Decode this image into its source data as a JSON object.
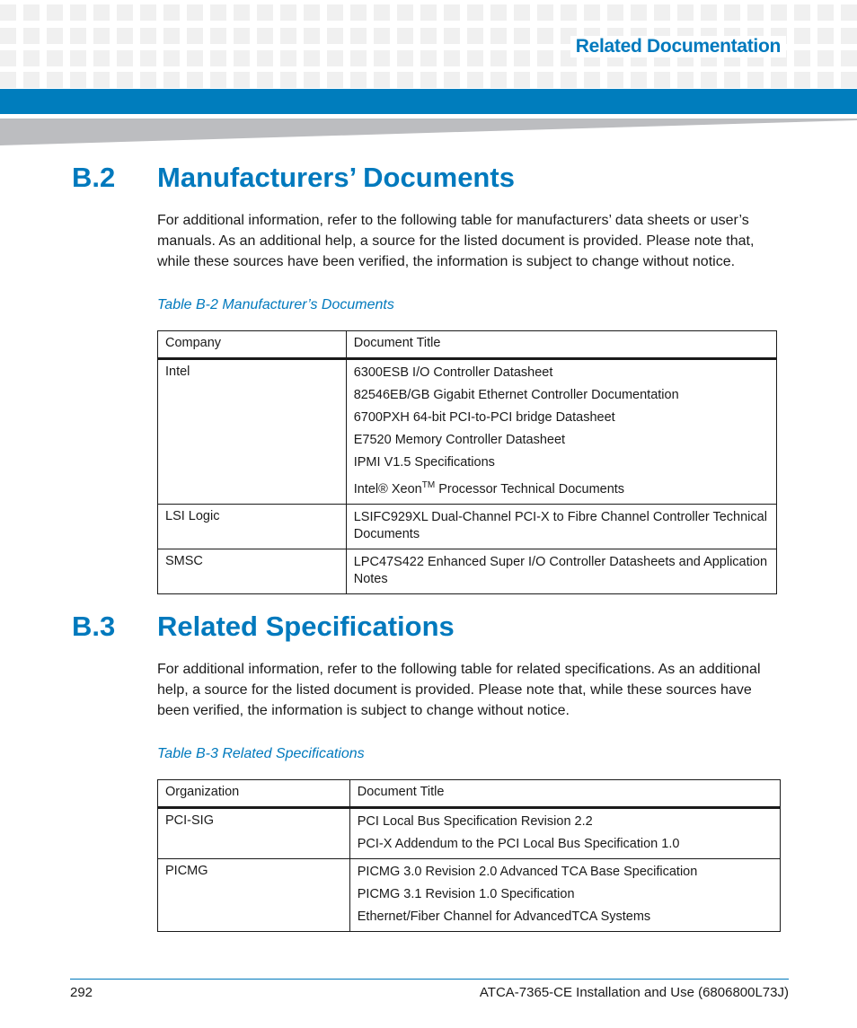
{
  "header": {
    "running_title": "Related Documentation",
    "colors": {
      "accent": "#0079bd",
      "band": "#007dbd",
      "wedge": "#bcbdc0"
    }
  },
  "section_b2": {
    "number": "B.2",
    "title": "Manufacturers’ Documents",
    "intro": "For additional information, refer to the following table for manufacturers’ data sheets or user’s manuals. As an additional help, a source for the listed document is provided. Please note that, while these sources have been verified, the information is subject to change without notice.",
    "table_caption": "Table B-2 Manufacturer’s Documents",
    "table": {
      "headers": [
        "Company",
        "Document Title"
      ],
      "rows": [
        {
          "company": "Intel",
          "docs": [
            "6300ESB I/O Controller Datasheet",
            "82546EB/GB Gigabit Ethernet Controller Documentation",
            "6700PXH 64-bit PCI-to-PCI bridge Datasheet",
            "E7520 Memory Controller Datasheet",
            "IPMI V1.5 Specifications"
          ],
          "xeon_doc": {
            "prefix": "Intel® Xeon",
            "sup": "TM",
            "suffix": " Processor Technical Documents"
          }
        },
        {
          "company": "LSI Logic",
          "docs": [
            "LSIFC929XL Dual-Channel PCI-X to Fibre Channel Controller Technical Documents"
          ]
        },
        {
          "company": "SMSC",
          "docs": [
            "LPC47S422 Enhanced Super I/O Controller Datasheets and Application Notes"
          ]
        }
      ]
    }
  },
  "section_b3": {
    "number": "B.3",
    "title": "Related Specifications",
    "intro": "For additional information, refer to the following table for related specifications. As an additional help, a source for the listed document is provided. Please note that, while these sources have been verified, the information is subject to change without notice.",
    "table_caption": "Table B-3 Related Specifications",
    "table": {
      "headers": [
        "Organization",
        "Document Title"
      ],
      "rows": [
        {
          "organization": "PCI-SIG",
          "docs": [
            "PCI Local Bus Specification Revision 2.2",
            "PCI-X Addendum to the PCI Local Bus Specification 1.0"
          ]
        },
        {
          "organization": "PICMG",
          "docs": [
            "PICMG 3.0 Revision 2.0 Advanced TCA Base Specification",
            "PICMG 3.1 Revision 1.0 Specification",
            "Ethernet/Fiber Channel for AdvancedTCA Systems"
          ]
        }
      ]
    }
  },
  "footer": {
    "page_number": "292",
    "document_title": "ATCA-7365-CE Installation and Use (6806800L73J)"
  }
}
